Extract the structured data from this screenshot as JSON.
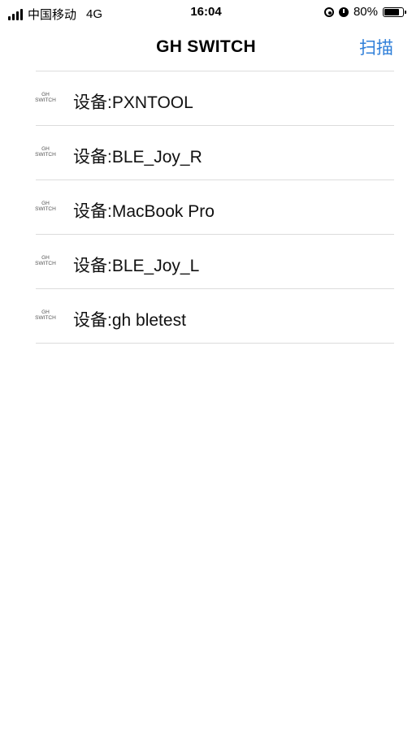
{
  "status_bar": {
    "carrier": "中国移动",
    "network": "4G",
    "time": "16:04",
    "battery_percent": "80%",
    "battery_level": 0.8
  },
  "nav": {
    "title": "GH SWITCH",
    "scan_label": "扫描",
    "accent_color": "#2f7fd9"
  },
  "devices": [
    {
      "label": "设备:PXNTOOL",
      "logo_top": "GH",
      "logo_bottom": "SWITCH"
    },
    {
      "label": "设备:BLE_Joy_R",
      "logo_top": "GH",
      "logo_bottom": "SWITCH"
    },
    {
      "label": "设备:MacBook Pro",
      "logo_top": "GH",
      "logo_bottom": "SWITCH"
    },
    {
      "label": "设备:BLE_Joy_L",
      "logo_top": "GH",
      "logo_bottom": "SWITCH"
    },
    {
      "label": "设备:gh bletest",
      "logo_top": "GH",
      "logo_bottom": "SWITCH"
    }
  ]
}
